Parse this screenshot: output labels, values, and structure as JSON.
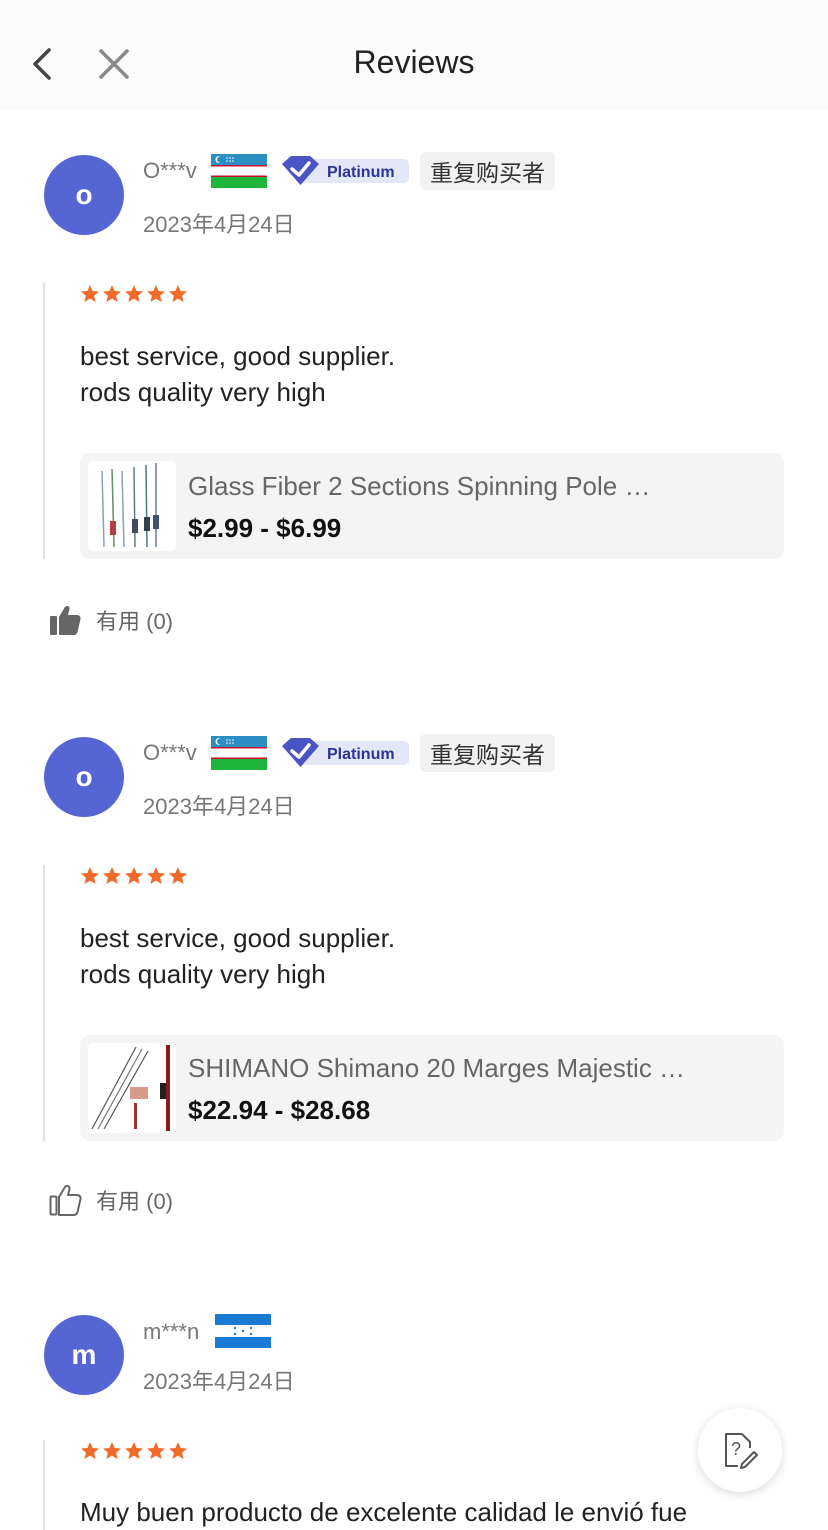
{
  "header": {
    "title": "Reviews"
  },
  "reviews": [
    {
      "avatar_letter": "o",
      "username": "O***v",
      "country_flag": "uzbekistan-flag",
      "platinum_badge": "Platinum",
      "repeat_badge": "重复购买者",
      "date": "2023年4月24日",
      "rating": 5,
      "text": "best service, good supplier.\nrods quality very high",
      "product": {
        "name": "Glass Fiber 2 Sections Spinning Pole …",
        "price": "$2.99 - $6.99"
      },
      "helpful": {
        "label": "有用 (0)",
        "active": true
      }
    },
    {
      "avatar_letter": "o",
      "username": "O***v",
      "country_flag": "uzbekistan-flag",
      "platinum_badge": "Platinum",
      "repeat_badge": "重复购买者",
      "date": "2023年4月24日",
      "rating": 5,
      "text": "best service, good supplier.\nrods quality very high",
      "product": {
        "name": "SHIMANO Shimano 20 Marges Majestic  …",
        "price": "$22.94 - $28.68"
      },
      "helpful": {
        "label": "有用 (0)",
        "active": false
      }
    },
    {
      "avatar_letter": "m",
      "username": "m***n",
      "country_flag": "honduras-flag",
      "date": "2023年4月24日",
      "rating": 5,
      "text": "Muy buen producto de excelente calidad le envió fue"
    }
  ],
  "colors": {
    "avatar": "#5566d4",
    "star": "#f06b2a",
    "platinum": "#4a54c4"
  },
  "icons": {
    "back": "chevron-left-icon",
    "close": "close-icon",
    "helpful": "thumbs-up-icon",
    "fab": "question-edit-icon"
  }
}
